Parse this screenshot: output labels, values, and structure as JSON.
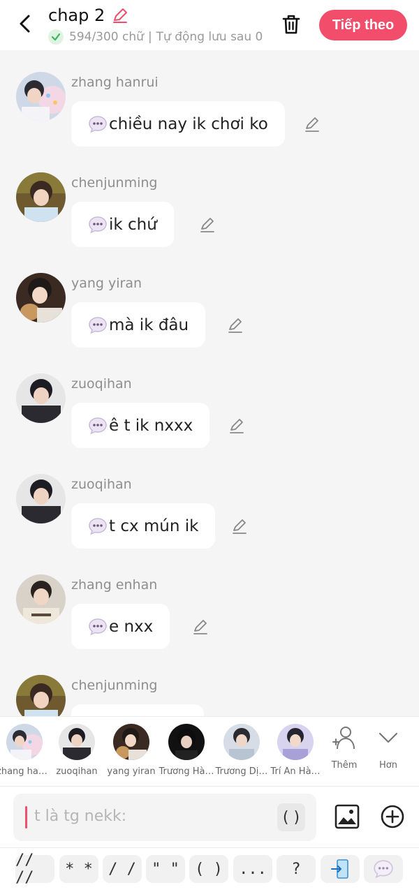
{
  "header": {
    "title": "chap 2",
    "word_count": "594/300 chữ",
    "separator": "|",
    "autosave": "Tự động lưu sau 0",
    "next_label": "Tiếp theo"
  },
  "messages": [
    {
      "sender": "zhang hanrui",
      "text": "chiều nay ik chơi ko",
      "avatar": "zhang-hanrui"
    },
    {
      "sender": "chenjunming",
      "text": "ik chứ",
      "avatar": "chenjunming"
    },
    {
      "sender": "yang yiran",
      "text": "mà ik đâu",
      "avatar": "yang-yiran"
    },
    {
      "sender": "zuoqihan",
      "text": "ê t ik nxxx",
      "avatar": "zuoqihan"
    },
    {
      "sender": "zuoqihan",
      "text": "t cx mún ik",
      "avatar": "zuoqihan"
    },
    {
      "sender": "zhang enhan",
      "text": "e nxx",
      "avatar": "zhang-enhan"
    },
    {
      "sender": "chenjunming",
      "text": "",
      "avatar": "chenjunming"
    }
  ],
  "characters": [
    {
      "name": "zhang han…",
      "avatar": "zhang-hanrui"
    },
    {
      "name": "zuoqihan",
      "avatar": "zuoqihan"
    },
    {
      "name": "yang yiran",
      "avatar": "yang-yiran"
    },
    {
      "name": "Trương Hà…",
      "avatar": "truong-ha"
    },
    {
      "name": "Trương Dị…",
      "avatar": "truong-di"
    },
    {
      "name": "Trí Ân Hà…",
      "avatar": "tri-an-ha"
    }
  ],
  "strip_actions": {
    "add_label": "Thêm",
    "more_label": "Hơn"
  },
  "input": {
    "placeholder": "t là tg nekk:",
    "paren_label": "( )"
  },
  "symbols": [
    "// //",
    "* *",
    "/ /",
    "\" \"",
    "( )",
    "...",
    "?"
  ],
  "colors": {
    "accent": "#f24d6a",
    "bubble_bg": "#ffffff",
    "page_bg": "#f5f5f5",
    "sender_text": "#8e8e8e",
    "check_green": "#3cb55a"
  }
}
